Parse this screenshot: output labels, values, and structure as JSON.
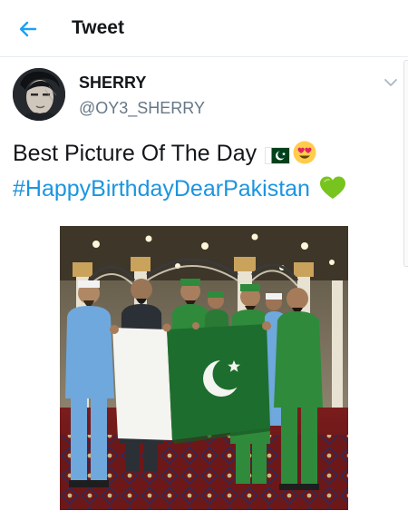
{
  "header": {
    "title": "Tweet",
    "back_icon": "arrow-left-icon"
  },
  "author": {
    "name": "SHERRY",
    "handle": "@OY3_SHERRY"
  },
  "tweet": {
    "text": "Best Picture Of The Day",
    "hashtag": "#HappyBirthdayDearPakistan",
    "emojis": [
      "pakistan-flag-icon",
      "heart-eyes-icon",
      "green-heart-icon"
    ]
  },
  "colors": {
    "accent": "#1da1f2",
    "hashtag": "#1b95e0",
    "text": "#14171a",
    "muted": "#657786",
    "flag_green": "#1d6e2e",
    "uniform_green": "#2f8a3c",
    "uniform_blue": "#6fa8dc"
  }
}
